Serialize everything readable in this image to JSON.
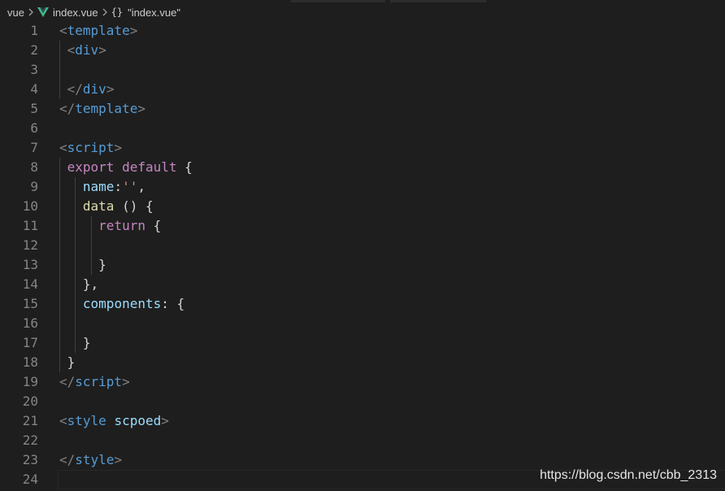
{
  "breadcrumb": {
    "folder": "vue",
    "file": "index.vue",
    "symbol_icon": "{}",
    "symbol": "\"index.vue\""
  },
  "icons": {
    "separator": "chevron-right-icon",
    "file_type": "vue-logo-icon",
    "symbol": "curly-braces-icon"
  },
  "colors": {
    "background": "#1e1e1e",
    "line_number": "#858585",
    "tag_bracket": "#808080",
    "tag_name": "#569cd6",
    "keyword": "#c586c0",
    "property": "#9cdcfe",
    "string": "#ce9178",
    "function": "#dcdcaa",
    "vue_logo": "#41b883"
  },
  "editor": {
    "current_line": 24,
    "lines": [
      {
        "n": "1",
        "tokens": [
          {
            "t": "<",
            "c": "tag"
          },
          {
            "t": "template",
            "c": "tagname"
          },
          {
            "t": ">",
            "c": "tag"
          }
        ]
      },
      {
        "n": "2",
        "tokens": [
          {
            "t": " ",
            "c": "punc"
          },
          {
            "t": "<",
            "c": "tag"
          },
          {
            "t": "div",
            "c": "tagname"
          },
          {
            "t": ">",
            "c": "tag"
          }
        ]
      },
      {
        "n": "3",
        "tokens": []
      },
      {
        "n": "4",
        "tokens": [
          {
            "t": " ",
            "c": "punc"
          },
          {
            "t": "</",
            "c": "tag"
          },
          {
            "t": "div",
            "c": "tagname"
          },
          {
            "t": ">",
            "c": "tag"
          }
        ]
      },
      {
        "n": "5",
        "tokens": [
          {
            "t": "</",
            "c": "tag"
          },
          {
            "t": "template",
            "c": "tagname"
          },
          {
            "t": ">",
            "c": "tag"
          }
        ]
      },
      {
        "n": "6",
        "tokens": []
      },
      {
        "n": "7",
        "tokens": [
          {
            "t": "<",
            "c": "tag"
          },
          {
            "t": "script",
            "c": "tagname"
          },
          {
            "t": ">",
            "c": "tag"
          }
        ]
      },
      {
        "n": "8",
        "tokens": [
          {
            "t": " ",
            "c": "punc"
          },
          {
            "t": "export",
            "c": "kw"
          },
          {
            "t": " ",
            "c": "punc"
          },
          {
            "t": "default",
            "c": "kw"
          },
          {
            "t": " {",
            "c": "punc"
          }
        ]
      },
      {
        "n": "9",
        "tokens": [
          {
            "t": "   ",
            "c": "punc"
          },
          {
            "t": "name",
            "c": "prop"
          },
          {
            "t": ":",
            "c": "punc"
          },
          {
            "t": "''",
            "c": "str"
          },
          {
            "t": ",",
            "c": "punc"
          }
        ]
      },
      {
        "n": "10",
        "tokens": [
          {
            "t": "   ",
            "c": "punc"
          },
          {
            "t": "data",
            "c": "fn"
          },
          {
            "t": " () {",
            "c": "punc"
          }
        ]
      },
      {
        "n": "11",
        "tokens": [
          {
            "t": "     ",
            "c": "punc"
          },
          {
            "t": "return",
            "c": "kw"
          },
          {
            "t": " {",
            "c": "punc"
          }
        ]
      },
      {
        "n": "12",
        "tokens": []
      },
      {
        "n": "13",
        "tokens": [
          {
            "t": "     }",
            "c": "punc"
          }
        ]
      },
      {
        "n": "14",
        "tokens": [
          {
            "t": "   },",
            "c": "punc"
          }
        ]
      },
      {
        "n": "15",
        "tokens": [
          {
            "t": "   ",
            "c": "punc"
          },
          {
            "t": "components",
            "c": "prop"
          },
          {
            "t": ": {",
            "c": "punc"
          }
        ]
      },
      {
        "n": "16",
        "tokens": []
      },
      {
        "n": "17",
        "tokens": [
          {
            "t": "   }",
            "c": "punc"
          }
        ]
      },
      {
        "n": "18",
        "tokens": [
          {
            "t": " }",
            "c": "punc"
          }
        ]
      },
      {
        "n": "19",
        "tokens": [
          {
            "t": "</",
            "c": "tag"
          },
          {
            "t": "script",
            "c": "tagname"
          },
          {
            "t": ">",
            "c": "tag"
          }
        ]
      },
      {
        "n": "20",
        "tokens": []
      },
      {
        "n": "21",
        "tokens": [
          {
            "t": "<",
            "c": "tag"
          },
          {
            "t": "style",
            "c": "tagname"
          },
          {
            "t": " ",
            "c": "punc"
          },
          {
            "t": "scpoed",
            "c": "attr"
          },
          {
            "t": ">",
            "c": "tag"
          }
        ]
      },
      {
        "n": "22",
        "tokens": []
      },
      {
        "n": "23",
        "tokens": [
          {
            "t": "</",
            "c": "tag"
          },
          {
            "t": "style",
            "c": "tagname"
          },
          {
            "t": ">",
            "c": "tag"
          }
        ]
      },
      {
        "n": "24",
        "tokens": []
      }
    ]
  },
  "watermark": "https://blog.csdn.net/cbb_2313"
}
